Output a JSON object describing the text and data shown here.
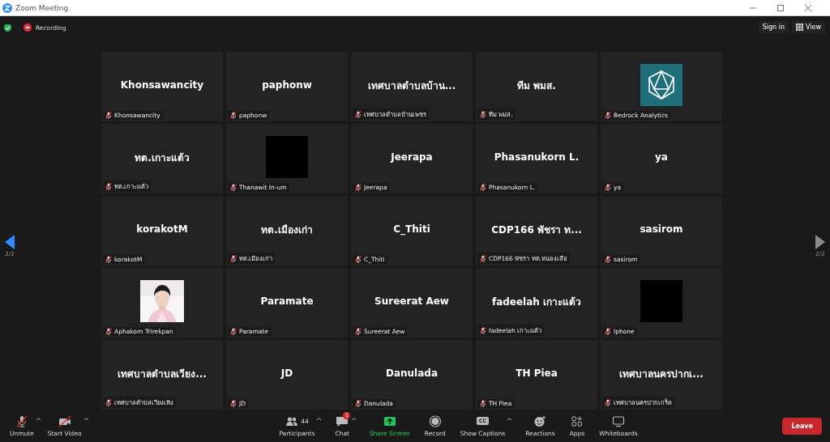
{
  "window": {
    "title": "Zoom Meeting"
  },
  "top_bar": {
    "recording": "Recording",
    "sign_in": "Sign in",
    "view": "View"
  },
  "pager": {
    "previous": {
      "label": "2/2",
      "disabled": false
    },
    "next": {
      "label": "2/2",
      "disabled": true
    }
  },
  "tiles": [
    {
      "kind": "name",
      "display": "Khonsawancity",
      "name": "Khonsawancity",
      "muted": true
    },
    {
      "kind": "name",
      "display": "paphonw",
      "name": "paphonw",
      "muted": true
    },
    {
      "kind": "name",
      "display": "เทศบาลตำบลบ้าน...",
      "name": "เทศบาลตำบลบ้านเพชร",
      "muted": true
    },
    {
      "kind": "name",
      "display": "ทีม พมส.",
      "name": "ทีม พมส.",
      "muted": true
    },
    {
      "kind": "logo",
      "name": "Bedrock Analytics",
      "muted": true
    },
    {
      "kind": "name",
      "display": "ทต.เกาะแต้ว",
      "name": "ทต.เกาะแต้ว",
      "muted": true
    },
    {
      "kind": "blank",
      "name": "Thanawit In-um",
      "muted": true
    },
    {
      "kind": "name",
      "display": "Jeerapa",
      "name": "Jeerapa",
      "muted": true
    },
    {
      "kind": "name",
      "display": "Phasanukorn L.",
      "name": "Phasanukorn L.",
      "muted": true
    },
    {
      "kind": "name",
      "display": "ya",
      "name": "ya",
      "muted": true
    },
    {
      "kind": "name",
      "display": "korakotM",
      "name": "korakotM",
      "muted": true
    },
    {
      "kind": "name",
      "display": "ทต.เมืองเก่า",
      "name": "ทต.เมืองเก่า",
      "muted": true
    },
    {
      "kind": "name",
      "display": "C_Thiti",
      "name": "C_Thiti",
      "muted": true
    },
    {
      "kind": "name",
      "display": "CDP166 พัชรา ท...",
      "name": "CDP166 พัชรา ทต.หนองเสือ",
      "muted": true
    },
    {
      "kind": "name",
      "display": "sasirom",
      "name": "sasirom",
      "muted": true
    },
    {
      "kind": "picture",
      "name": "Aphakorn Trirekpan",
      "muted": true
    },
    {
      "kind": "name",
      "display": "Paramate",
      "name": "Paramate",
      "muted": true
    },
    {
      "kind": "name",
      "display": "Sureerat Aew",
      "name": "Sureerat Aew",
      "muted": true
    },
    {
      "kind": "name",
      "display": "fadeelah เกาะแต้ว",
      "name": "fadeelah เกาะแต้ว",
      "muted": true
    },
    {
      "kind": "blank",
      "name": "Iphone",
      "muted": true
    },
    {
      "kind": "name",
      "display": "เทศบาลตำบลเวียง...",
      "name": "เทศบาลตำบลเวียงเหิง",
      "muted": true
    },
    {
      "kind": "name",
      "display": "JD",
      "name": "JD",
      "muted": true
    },
    {
      "kind": "name",
      "display": "Danulada",
      "name": "Danulada",
      "muted": true
    },
    {
      "kind": "name",
      "display": "TH Piea",
      "name": "TH Piea",
      "muted": true
    },
    {
      "kind": "name",
      "display": "เทศบาลนครปากเ...",
      "name": "เทศบาลนครปากเกร็ด",
      "muted": true
    }
  ],
  "toolbar": {
    "left": [
      {
        "kind": "mic",
        "label": "Unmute",
        "muted": true,
        "caret": true
      },
      {
        "kind": "video",
        "label": "Start Video",
        "muted": true,
        "caret": true
      }
    ],
    "center": [
      {
        "kind": "participants",
        "label": "Participants",
        "count": "44",
        "caret": true
      },
      {
        "kind": "chat",
        "label": "Chat",
        "badge": "1",
        "caret": true
      },
      {
        "kind": "share",
        "label": "Share Screen"
      },
      {
        "kind": "record",
        "label": "Record"
      },
      {
        "kind": "captions",
        "label": "Show Captions",
        "icon_text": "CC",
        "caret": true
      },
      {
        "kind": "reactions",
        "label": "Reactions"
      },
      {
        "kind": "apps",
        "label": "Apps"
      },
      {
        "kind": "whiteboards",
        "label": "Whiteboards"
      }
    ],
    "leave": "Leave"
  }
}
